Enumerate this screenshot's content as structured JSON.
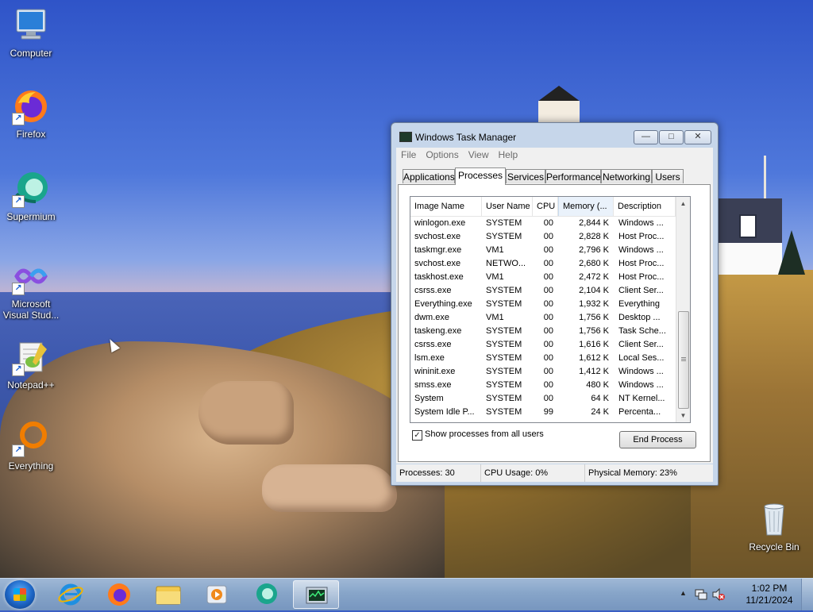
{
  "desktop": {
    "icons": [
      {
        "label": "Computer"
      },
      {
        "label": "Firefox"
      },
      {
        "label": "Supermium"
      },
      {
        "label": "Microsoft Visual Stud..."
      },
      {
        "label": "Notepad++"
      },
      {
        "label": "Everything"
      },
      {
        "label": "Recycle Bin"
      }
    ]
  },
  "window": {
    "title": "Windows Task Manager",
    "controls": {
      "minimize": "—",
      "maximize": "□",
      "close": "✕"
    },
    "menu": [
      "File",
      "Options",
      "View",
      "Help"
    ],
    "tabs": [
      "Applications",
      "Processes",
      "Services",
      "Performance",
      "Networking",
      "Users"
    ],
    "active_tab": "Processes",
    "columns": [
      "Image Name",
      "User Name",
      "CPU",
      "Memory (...",
      "Description"
    ],
    "processes": [
      {
        "name": "winlogon.exe",
        "user": "SYSTEM",
        "cpu": "00",
        "mem": "2,844 K",
        "desc": "Windows ..."
      },
      {
        "name": "svchost.exe",
        "user": "SYSTEM",
        "cpu": "00",
        "mem": "2,828 K",
        "desc": "Host Proc..."
      },
      {
        "name": "taskmgr.exe",
        "user": "VM1",
        "cpu": "00",
        "mem": "2,796 K",
        "desc": "Windows ..."
      },
      {
        "name": "svchost.exe",
        "user": "NETWO...",
        "cpu": "00",
        "mem": "2,680 K",
        "desc": "Host Proc..."
      },
      {
        "name": "taskhost.exe",
        "user": "VM1",
        "cpu": "00",
        "mem": "2,472 K",
        "desc": "Host Proc..."
      },
      {
        "name": "csrss.exe",
        "user": "SYSTEM",
        "cpu": "00",
        "mem": "2,104 K",
        "desc": "Client Ser..."
      },
      {
        "name": "Everything.exe",
        "user": "SYSTEM",
        "cpu": "00",
        "mem": "1,932 K",
        "desc": "Everything"
      },
      {
        "name": "dwm.exe",
        "user": "VM1",
        "cpu": "00",
        "mem": "1,756 K",
        "desc": "Desktop ..."
      },
      {
        "name": "taskeng.exe",
        "user": "SYSTEM",
        "cpu": "00",
        "mem": "1,756 K",
        "desc": "Task Sche..."
      },
      {
        "name": "csrss.exe",
        "user": "SYSTEM",
        "cpu": "00",
        "mem": "1,616 K",
        "desc": "Client Ser..."
      },
      {
        "name": "lsm.exe",
        "user": "SYSTEM",
        "cpu": "00",
        "mem": "1,612 K",
        "desc": "Local Ses..."
      },
      {
        "name": "wininit.exe",
        "user": "SYSTEM",
        "cpu": "00",
        "mem": "1,412 K",
        "desc": "Windows ..."
      },
      {
        "name": "smss.exe",
        "user": "SYSTEM",
        "cpu": "00",
        "mem": "480 K",
        "desc": "Windows ..."
      },
      {
        "name": "System",
        "user": "SYSTEM",
        "cpu": "00",
        "mem": "64 K",
        "desc": "NT Kernel..."
      },
      {
        "name": "System Idle P...",
        "user": "SYSTEM",
        "cpu": "99",
        "mem": "24 K",
        "desc": "Percenta..."
      }
    ],
    "show_all_label": "Show processes from all users",
    "show_all_checked": true,
    "end_process_label": "End Process",
    "status": {
      "processes": "Processes: 30",
      "cpu": "CPU Usage: 0%",
      "memory": "Physical Memory: 23%"
    }
  },
  "taskbar": {
    "apps": [
      "internet-explorer-icon",
      "firefox-icon",
      "file-explorer-icon",
      "media-player-icon",
      "supermium-icon",
      "task-manager-icon"
    ],
    "clock_time": "1:02 PM",
    "clock_date": "11/21/2024"
  },
  "colors": {
    "accent": "#1c64c4",
    "window_frame": "#c6d6ea",
    "taskbar": "#87a5c9"
  }
}
